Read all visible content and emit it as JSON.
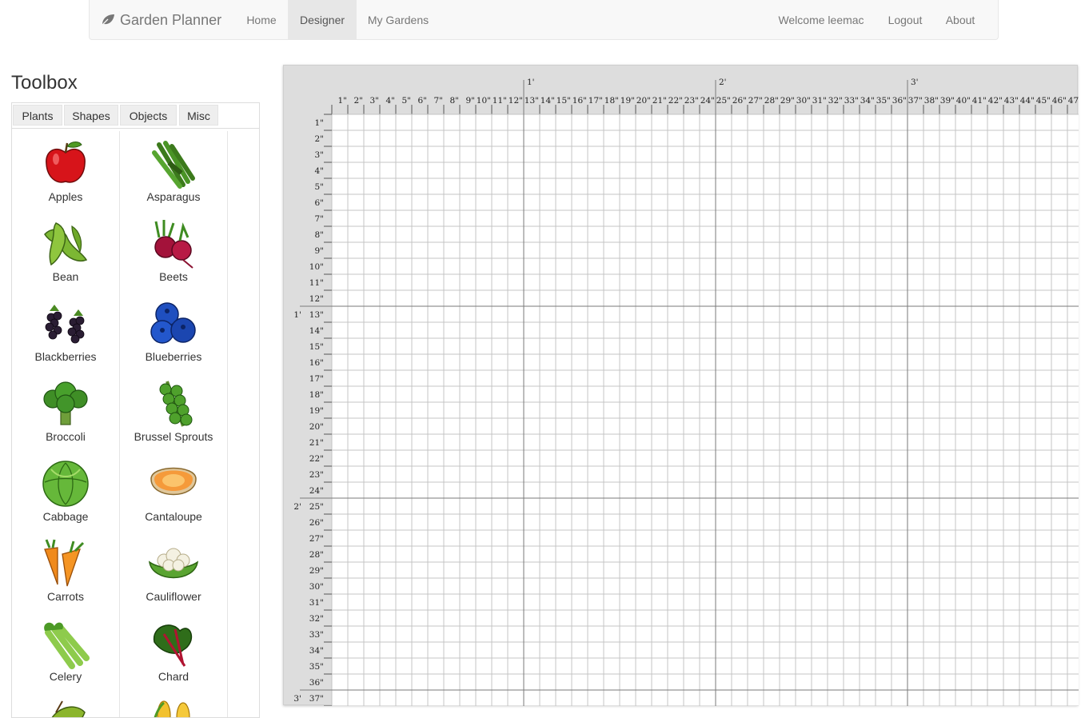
{
  "navbar": {
    "brand": "Garden Planner",
    "links": {
      "home": "Home",
      "designer": "Designer",
      "my_gardens": "My Gardens"
    },
    "welcome": "Welcome leemac",
    "logout": "Logout",
    "about": "About"
  },
  "toolbox": {
    "title": "Toolbox",
    "tabs": [
      "Plants",
      "Shapes",
      "Objects",
      "Misc"
    ],
    "plants": [
      {
        "label": "Apples",
        "icon": "apple-icon"
      },
      {
        "label": "Asparagus",
        "icon": "asparagus-icon"
      },
      {
        "label": "Bean",
        "icon": "bean-icon"
      },
      {
        "label": "Beets",
        "icon": "beets-icon"
      },
      {
        "label": "Blackberries",
        "icon": "blackberries-icon"
      },
      {
        "label": "Blueberries",
        "icon": "blueberries-icon"
      },
      {
        "label": "Broccoli",
        "icon": "broccoli-icon"
      },
      {
        "label": "Brussel Sprouts",
        "icon": "brussel-sprouts-icon"
      },
      {
        "label": "Cabbage",
        "icon": "cabbage-icon"
      },
      {
        "label": "Cantaloupe",
        "icon": "cantaloupe-icon"
      },
      {
        "label": "Carrots",
        "icon": "carrots-icon"
      },
      {
        "label": "Cauliflower",
        "icon": "cauliflower-icon"
      },
      {
        "label": "Celery",
        "icon": "celery-icon"
      },
      {
        "label": "Chard",
        "icon": "chard-icon"
      },
      {
        "label": "",
        "icon": "leaf-icon"
      },
      {
        "label": "",
        "icon": "corn-icon"
      }
    ]
  },
  "designer": {
    "columns_inches": 47,
    "rows_inches": 37,
    "inch_suffix": "\"",
    "foot_suffix": "'",
    "feet_marks": [
      1,
      2,
      3
    ]
  }
}
